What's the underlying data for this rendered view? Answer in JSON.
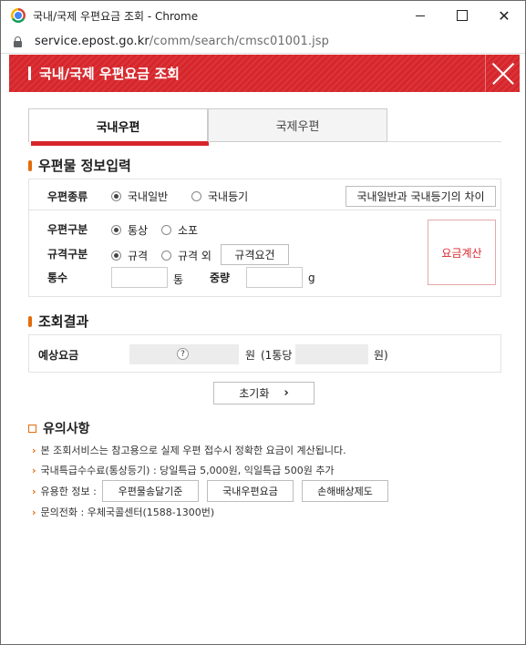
{
  "window": {
    "title": "국내/국제 우편요금 조회 - Chrome",
    "close_glyph": "✕"
  },
  "address": {
    "host": "service.epost.go.kr",
    "path": "/comm/search/cmsc01001.jsp"
  },
  "header": {
    "title": "국내/국제 우편요금 조회"
  },
  "tabs": [
    {
      "label": "국내우편",
      "active": true
    },
    {
      "label": "국제우편",
      "active": false
    }
  ],
  "input_section": {
    "title": "우편물 정보입력",
    "mail_type": {
      "label": "우편종류",
      "options": [
        {
          "label": "국내일반",
          "checked": true
        },
        {
          "label": "국내등기",
          "checked": false
        }
      ],
      "diff_button": "국내일반과 국내등기의 차이"
    },
    "mail_class": {
      "label": "우편구분",
      "options": [
        {
          "label": "통상",
          "checked": true
        },
        {
          "label": "소포",
          "checked": false
        }
      ]
    },
    "size_class": {
      "label": "규격구분",
      "options": [
        {
          "label": "규격",
          "checked": true
        },
        {
          "label": "규격 외",
          "checked": false
        }
      ],
      "requirement_button": "규격요건"
    },
    "count": {
      "label": "통수",
      "value": "",
      "unit": "통"
    },
    "weight": {
      "label": "중량",
      "value": "",
      "unit": "g"
    },
    "calc_button": "요금계산"
  },
  "result_section": {
    "title": "조회결과",
    "label": "예상요금",
    "help_glyph": "?",
    "unit": "원",
    "per_unit_prefix": "(1통당",
    "per_unit_suffix": "원)"
  },
  "reset_button": {
    "label": "초기화",
    "arrow": "›"
  },
  "notice": {
    "title": "유의사항",
    "bullet": "›",
    "items": [
      "본 조회서비스는 참고용으로 실제 우편 접수시 정확한 요금이 계산됩니다.",
      "국내특급수수료(통상등기) : 당일특급 5,000원, 익일특급 500원 추가",
      "유용한 정보 :",
      "문의전화 : 우체국콜센터(1588-1300번)"
    ],
    "info_buttons": [
      "우편물송달기준",
      "국내우편요금",
      "손해배상제도"
    ]
  },
  "colors": {
    "brand_red": "#d6262b",
    "accent_orange": "#e36c0a"
  }
}
